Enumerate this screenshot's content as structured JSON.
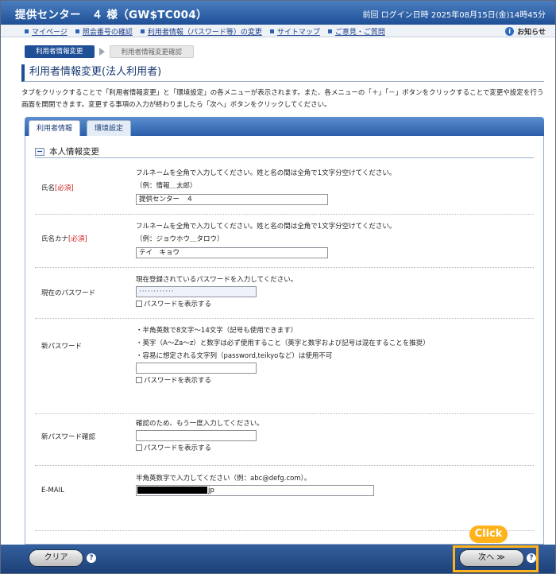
{
  "header": {
    "title": "提供センター　４ 様（GW$TC004）",
    "login": "前回 ログイン日時 2025年08月15日(金)14時45分"
  },
  "nav": {
    "links": [
      "マイページ",
      "照会番号の確認",
      "利用者情報（パスワード等）の変更",
      "サイトマップ",
      "ご意見・ご質問"
    ],
    "notice": "お知らせ"
  },
  "steps": {
    "current": "利用者情報変更",
    "next": "利用者情報変更確認"
  },
  "page": {
    "heading": "利用者情報変更(法人利用者)",
    "description": "タブをクリックすることで「利用者情報変更」と「環境設定」の各メニューが表示されます。また、各メニューの「＋」「－」ボタンをクリックすることで変更や設定を行う画面を開閉できます。変更する事項の入力が終わりましたら「次へ」ボタンをクリックしてください。"
  },
  "tabs": {
    "user_info": "利用者情報",
    "env_settings": "環境設定"
  },
  "section": {
    "title": "本人情報変更"
  },
  "form": {
    "name": {
      "label": "氏名",
      "required": "[必須]",
      "help1": "フルネームを全角で入力してください。姓と名の間は全角で1文字分空けてください。",
      "help2": "（例：情報＿太郎）",
      "value": "提供センター　４"
    },
    "kana": {
      "label": "氏名カナ",
      "required": "[必須]",
      "help1": "フルネームを全角で入力してください。姓と名の間は全角で1文字分空けてください。",
      "help2": "（例：ジョウホウ＿タロウ）",
      "value": "テイ　キョウ"
    },
    "current_pw": {
      "label": "現在のパスワード",
      "help1": "現在登録されているパスワードを入力してください。",
      "value": "············",
      "show": "パスワードを表示する"
    },
    "new_pw": {
      "label": "新パスワード",
      "rule1": "・半角英数で8文字～14文字（記号も使用できます）",
      "rule2": "・英字（A～Za～z）と数字は必ず使用すること（英字と数字および記号は混在することを推奨）",
      "rule3": "・容易に想定される文字列（password,teikyoなど）は使用不可",
      "value": "",
      "show": "パスワードを表示する"
    },
    "new_pw_confirm": {
      "label": "新パスワード確認",
      "help1": "確認のため、もう一度入力してください。",
      "value": "",
      "show": "パスワードを表示する"
    },
    "email": {
      "label": "E-MAIL",
      "help1": "半角英数字で入力してください（例：abc@defg.com）。",
      "value_suffix": "jp"
    }
  },
  "footer": {
    "clear": "クリア",
    "next": "次へ ≫",
    "help": "?"
  },
  "annotation": {
    "click": "Click"
  },
  "colors": {
    "brand": "#1f4f96",
    "required": "#d2201b",
    "highlight": "#ffb21a"
  }
}
